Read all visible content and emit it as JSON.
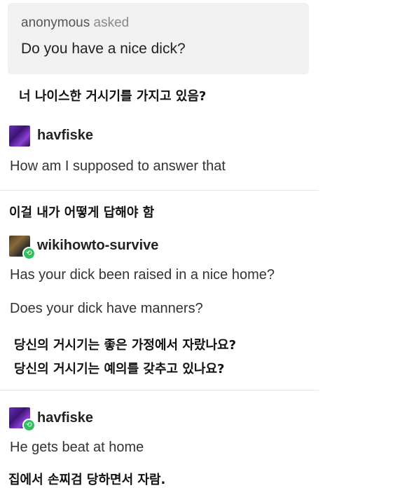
{
  "ask": {
    "username": "anonymous",
    "asked_label": "asked",
    "question": "Do you have a nice dick?"
  },
  "translations": {
    "t1": "너 나이스한 거시기를 가지고 있음?",
    "t2": "이걸 내가 어떻게 답해야 함",
    "t3a": "당신의 거시기는 좋은 가정에서 자랐나요?",
    "t3b": "당신의 거시기는 예의를 갖추고 있나요?",
    "t4": "집에서 손찌검 당하면서 자람."
  },
  "posts": [
    {
      "username": "havfiske",
      "avatar": "purple-avatar",
      "lines": [
        "How am I supposed to answer that"
      ]
    },
    {
      "username": "wikihowto-survive",
      "avatar": "dark-avatar",
      "reblog": true,
      "lines": [
        "Has your dick been raised in a nice home?",
        "Does your dick have manners?"
      ]
    },
    {
      "username": "havfiske",
      "avatar": "purple-avatar",
      "reblog": true,
      "lines": [
        "He gets beat at home"
      ]
    }
  ],
  "colors": {
    "ask_bg": "#f1f1f1",
    "reblog_badge": "#2fbf5c"
  },
  "icons": {
    "reblog": "reblog-icon"
  }
}
